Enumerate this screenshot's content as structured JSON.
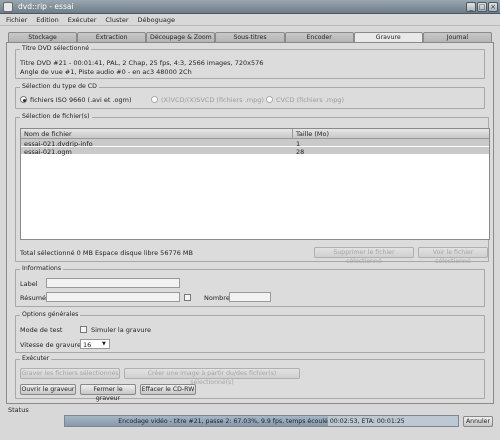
{
  "window": {
    "title": "dvd::rip - essai"
  },
  "menu": [
    "Fichier",
    "Edition",
    "Exécuter",
    "Cluster",
    "Déboguage"
  ],
  "tabs": [
    {
      "label": "Stockage"
    },
    {
      "label": "Extraction"
    },
    {
      "label": "Découpage & Zoom"
    },
    {
      "label": "Sous-titres"
    },
    {
      "label": "Encoder"
    },
    {
      "label": "Gravure",
      "active": true
    },
    {
      "label": "Journal"
    }
  ],
  "dvd_title": {
    "header": "Titre DVD sélectionné",
    "line1": "Titre DVD #21 - 00:01:41, PAL, 2 Chap, 25 fps, 4:3, 2566 images, 720x576",
    "line2": "Angle de vue #1, Piste audio #0 - en ac3 48000 2Ch"
  },
  "cd_type": {
    "header": "Sélection du type de CD",
    "options": [
      {
        "label": "fichiers ISO 9660 (.avi et .ogm)",
        "selected": true,
        "enabled": true
      },
      {
        "label": "(X)VCD/(X)SVCD (fichiers .mpg)",
        "selected": false,
        "enabled": false
      },
      {
        "label": "CVCD (fichiers .mpg)",
        "selected": false,
        "enabled": false
      }
    ]
  },
  "files": {
    "header": "Sélection de fichier(s)",
    "columns": [
      "Nom de fichier",
      "Taille (Mo)"
    ],
    "rows": [
      {
        "name": "essai-021.dvdrip-info",
        "size": "1"
      },
      {
        "name": "essai-021.ogm",
        "size": "28"
      }
    ],
    "total": "Total sélectionné 0 MB  Espace disque libre 56776 MB",
    "delete_button": "Supprimer le fichier sélectionné",
    "view_button": "Voir le fichier sélectionné"
  },
  "informations": {
    "header": "Informations",
    "label_label": "Label",
    "label_value": "",
    "summary_label": "Résumé",
    "summary_value": "",
    "number_label": "Nombre",
    "number_value": ""
  },
  "general": {
    "header": "Options générales",
    "test_mode_label": "Mode de test",
    "simulate_label": "Simuler la gravure",
    "speed_label": "Vitesse de gravure",
    "speed_value": "16"
  },
  "execute": {
    "header": "Exécuter",
    "buttons_row1": [
      {
        "label": "Graver les fichiers sélectionnés",
        "enabled": false
      },
      {
        "label": "Créer une image à partir du/des fichier(s) sélectionné(s)",
        "enabled": false
      }
    ],
    "buttons_row2": [
      {
        "label": "Ouvrir le graveur",
        "enabled": true
      },
      {
        "label": "Fermer le graveur",
        "enabled": true
      },
      {
        "label": "Effacer le CD-RW",
        "enabled": true
      }
    ]
  },
  "status": {
    "label": "Status",
    "progress_text": "Encodage vidéo - titre #21, passe 2: 67.03%,  9.9 fps, temps écoulé 00:02:53, ETA: 00:01:25",
    "progress_fraction": 0.6703,
    "cancel_button": "Annuler"
  }
}
